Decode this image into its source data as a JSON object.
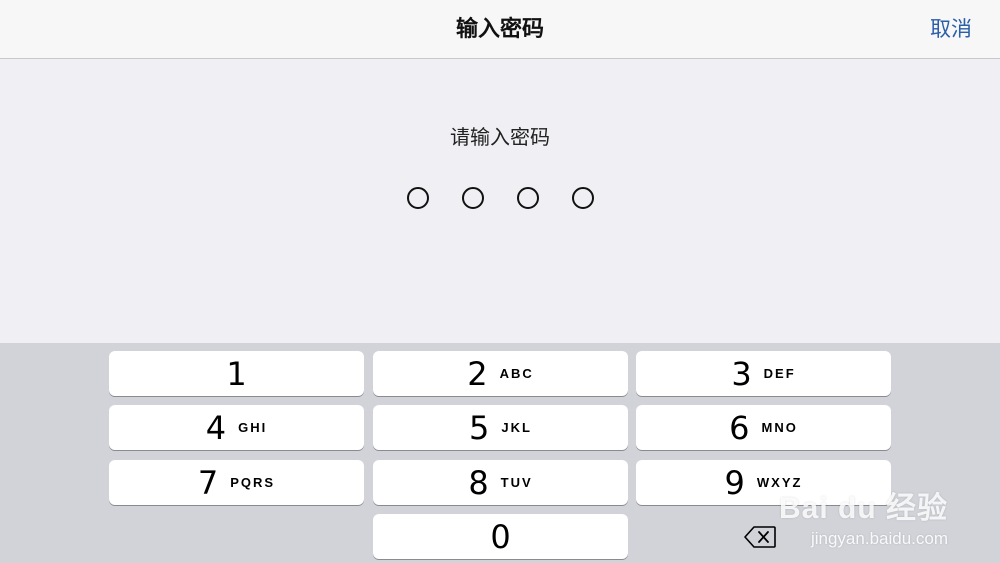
{
  "navbar": {
    "title": "输入密码",
    "cancel_label": "取消"
  },
  "prompt": {
    "text": "请输入密码"
  },
  "passcode": {
    "length": 4,
    "entered": 0
  },
  "keypad": {
    "keys": [
      {
        "digit": "1",
        "letters": ""
      },
      {
        "digit": "2",
        "letters": "ABC"
      },
      {
        "digit": "3",
        "letters": "DEF"
      },
      {
        "digit": "4",
        "letters": "GHI"
      },
      {
        "digit": "5",
        "letters": "JKL"
      },
      {
        "digit": "6",
        "letters": "MNO"
      },
      {
        "digit": "7",
        "letters": "PQRS"
      },
      {
        "digit": "8",
        "letters": "TUV"
      },
      {
        "digit": "9",
        "letters": "WXYZ"
      },
      {
        "digit": "0",
        "letters": ""
      }
    ],
    "delete_icon": "backspace-icon"
  },
  "watermark": {
    "brand": "Bai du 经验",
    "url": "jingyan.baidu.com"
  },
  "colors": {
    "accent": "#2a5ea8",
    "background": "#efeff4",
    "keypad_background": "#d1d3d9",
    "key_background": "#ffffff"
  }
}
